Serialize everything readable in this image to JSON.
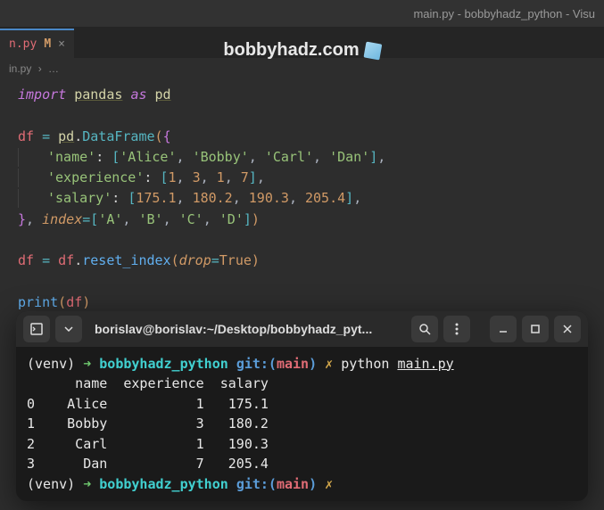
{
  "window": {
    "title": "main.py - bobbyhadz_python - Visu"
  },
  "watermark": {
    "text": "bobbyhadz.com"
  },
  "tab": {
    "name": "n.py",
    "modified": "M",
    "close": "×"
  },
  "breadcrumb": {
    "file": "in.py",
    "rest": "…"
  },
  "code": {
    "l1": {
      "import": "import",
      "pandas": "pandas",
      "as": "as",
      "pd": "pd"
    },
    "l2": {
      "df": "df",
      "eq": "=",
      "pd2": "pd",
      "dot": ".",
      "DataFrame": "DataFrame",
      "lp": "(",
      "lb": "{"
    },
    "l3": {
      "name": "'name'",
      "colon": ":",
      "lb": "[",
      "alice": "'Alice'",
      "c1": ",",
      "bobby": "'Bobby'",
      "c2": ",",
      "carl": "'Carl'",
      "c3": ",",
      "dan": "'Dan'",
      "rb": "]",
      "c4": ","
    },
    "l4": {
      "exp": "'experience'",
      "colon": ":",
      "lb": "[",
      "n1": "1",
      "c1": ",",
      "n2": "3",
      "c2": ",",
      "n3": "1",
      "c3": ",",
      "n4": "7",
      "rb": "]",
      "c4": ","
    },
    "l5": {
      "sal": "'salary'",
      "colon": ":",
      "lb": "[",
      "n1": "175.1",
      "c1": ",",
      "n2": "180.2",
      "c2": ",",
      "n3": "190.3",
      "c3": ",",
      "n4": "205.4",
      "rb": "]",
      "c4": ","
    },
    "l6": {
      "rb": "}",
      "c1": ",",
      "index": "index",
      "eq": "=",
      "lb": "[",
      "a": "'A'",
      "c2": ",",
      "b": "'B'",
      "c3": ",",
      "cc": "'C'",
      "c4": ",",
      "d": "'D'",
      "rb2": "]",
      "rp": ")"
    },
    "l7": {
      "df": "df",
      "eq": "=",
      "df2": "df",
      "dot": ".",
      "reset": "reset_index",
      "lp": "(",
      "drop": "drop",
      "eq2": "=",
      "true": "True",
      "rp": ")"
    },
    "l8": {
      "print": "print",
      "lp": "(",
      "df": "df",
      "rp": ")"
    }
  },
  "terminal": {
    "header": {
      "title": "borislav@borislav:~/Desktop/bobbyhadz_pyt..."
    },
    "lines": {
      "p1": {
        "venv": "(venv)",
        "arrow": "➜",
        "dir": "bobbyhadz_python",
        "git": "git:(",
        "branch": "main",
        "gitclose": ")",
        "x": "✗",
        "cmd": "python",
        "file": "main.py"
      },
      "header": "      name  experience  salary",
      "r0": "0    Alice           1   175.1",
      "r1": "1    Bobby           3   180.2",
      "r2": "2     Carl           1   190.3",
      "r3": "3      Dan           7   205.4",
      "p2": {
        "venv": "(venv)",
        "arrow": "➜",
        "dir": "bobbyhadz_python",
        "git": "git:(",
        "branch": "main",
        "gitclose": ")",
        "x": "✗"
      }
    }
  },
  "chart_data": {
    "type": "table",
    "title": "DataFrame output",
    "columns": [
      "",
      "name",
      "experience",
      "salary"
    ],
    "rows": [
      [
        0,
        "Alice",
        1,
        175.1
      ],
      [
        1,
        "Bobby",
        3,
        180.2
      ],
      [
        2,
        "Carl",
        1,
        190.3
      ],
      [
        3,
        "Dan",
        7,
        205.4
      ]
    ]
  }
}
